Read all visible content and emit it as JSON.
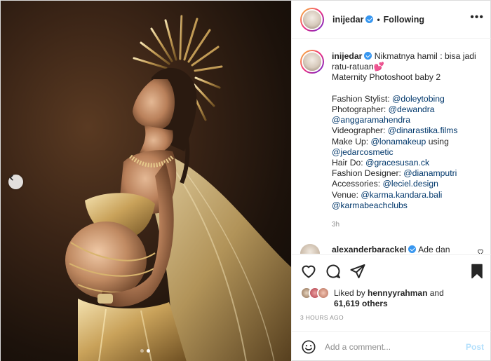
{
  "post": {
    "username": "inijedar",
    "follow_separator": "•",
    "follow_status": "Following",
    "more_icon": "more-horizontal-icon",
    "carousel": {
      "total_slides": 2,
      "active_slide": 2
    }
  },
  "caption": {
    "username": "inijedar",
    "line1": "Nikmatnya hamil : bisa jadi ratu-ratuan💕",
    "line2": "Maternity Photoshoot baby 2",
    "credits": [
      {
        "label": "Fashion Stylist:",
        "mentions": [
          "@doleytobing"
        ]
      },
      {
        "label": "Photographer:",
        "mentions": [
          "@dewandra",
          "@anggaramahendra"
        ]
      },
      {
        "label": "Videographer:",
        "mentions": [
          "@dinarastika.films"
        ]
      },
      {
        "label": "Make Up:",
        "mentions": [
          "@lonamakeup"
        ],
        "suffix": "using",
        "extra": "@jedarcosmetic"
      },
      {
        "label": "Hair Do:",
        "mentions": [
          "@gracesusan.ck"
        ]
      },
      {
        "label": "Fashion Designer:",
        "mentions": [
          "@dianamputri"
        ]
      },
      {
        "label": "Accessories:",
        "mentions": [
          "@leciel.design"
        ]
      },
      {
        "label": "Venue:",
        "mentions": [
          "@karma.kandara.bali",
          "@karmabeachclubs"
        ]
      }
    ],
    "time": "3h"
  },
  "comment": {
    "username": "alexanderbarackel",
    "text": "Ade dan"
  },
  "likes": {
    "prefix": "Liked by",
    "user": "hennyyrahman",
    "connector": "and",
    "others": "61,619 others"
  },
  "posted_ago": "3 HOURS AGO",
  "add_comment": {
    "placeholder": "Add a comment...",
    "post_label": "Post"
  },
  "colors": {
    "mention": "#00376b",
    "verified": "#3897f0",
    "post_disabled": "#b2dffc",
    "secondary_text": "#8e8e8e"
  }
}
